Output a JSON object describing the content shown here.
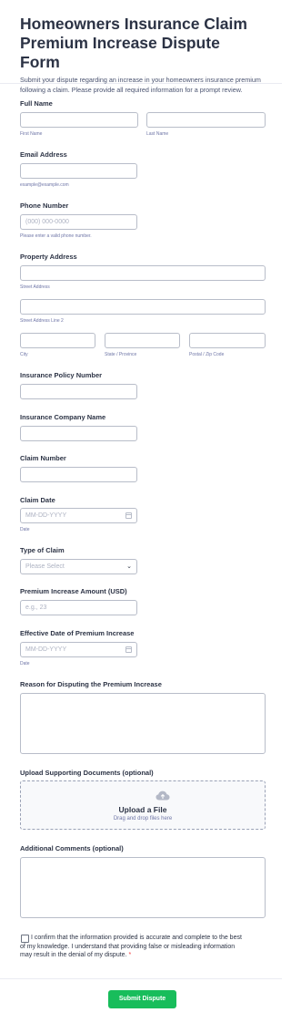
{
  "form": {
    "title": "Homeowners Insurance Claim Premium Increase Dispute Form",
    "subtitle": "Submit your dispute regarding an increase in your homeowners insurance premium following a claim. Please provide all required information for a prompt review."
  },
  "fields": {
    "full_name": {
      "label": "Full Name",
      "first_sub": "First Name",
      "last_sub": "Last Name",
      "first_value": "",
      "last_value": ""
    },
    "email": {
      "label": "Email Address",
      "sub": "example@example.com",
      "value": ""
    },
    "phone": {
      "label": "Phone Number",
      "placeholder": "(000) 000-0000",
      "sub": "Please enter a valid phone number."
    },
    "address": {
      "label": "Property Address",
      "street_sub": "Street Address",
      "street2_sub": "Street Address Line 2",
      "city_sub": "City",
      "state_sub": "State / Province",
      "postal_sub": "Postal / Zip Code"
    },
    "policy_number": {
      "label": "Insurance Policy Number"
    },
    "company_name": {
      "label": "Insurance Company Name"
    },
    "claim_number": {
      "label": "Claim Number"
    },
    "claim_date": {
      "label": "Claim Date",
      "placeholder": "MM-DD-YYYY",
      "sub": "Date",
      "icon": "calendar-icon"
    },
    "claim_type": {
      "label": "Type of Claim",
      "selected": "Please Select",
      "icon": "chevron-down-icon"
    },
    "premium_increase": {
      "label": "Premium Increase Amount (USD)",
      "placeholder": "e.g., 23"
    },
    "effective_date": {
      "label": "Effective Date of Premium Increase",
      "placeholder": "MM-DD-YYYY",
      "sub": "Date",
      "icon": "calendar-icon"
    },
    "reason": {
      "label": "Reason for Disputing the Premium Increase",
      "value": ""
    },
    "upload": {
      "label": "Upload Supporting Documents (optional)",
      "title": "Upload a File",
      "hint": "Drag and drop files here",
      "icon": "cloud-upload-icon"
    },
    "comments": {
      "label": "Additional Comments (optional)",
      "value": ""
    },
    "consent": {
      "text": "I confirm that the information provided is accurate and complete to the best of my knowledge. I understand that providing false or misleading information may result in the denial of my dispute.",
      "required_mark": "*"
    }
  },
  "actions": {
    "submit_label": "Submit Dispute"
  },
  "colors": {
    "accent": "#18bd5b",
    "required": "#f23a3c",
    "text": "#2c3345",
    "muted": "#6f76a7",
    "border": "#b8bdc9"
  }
}
